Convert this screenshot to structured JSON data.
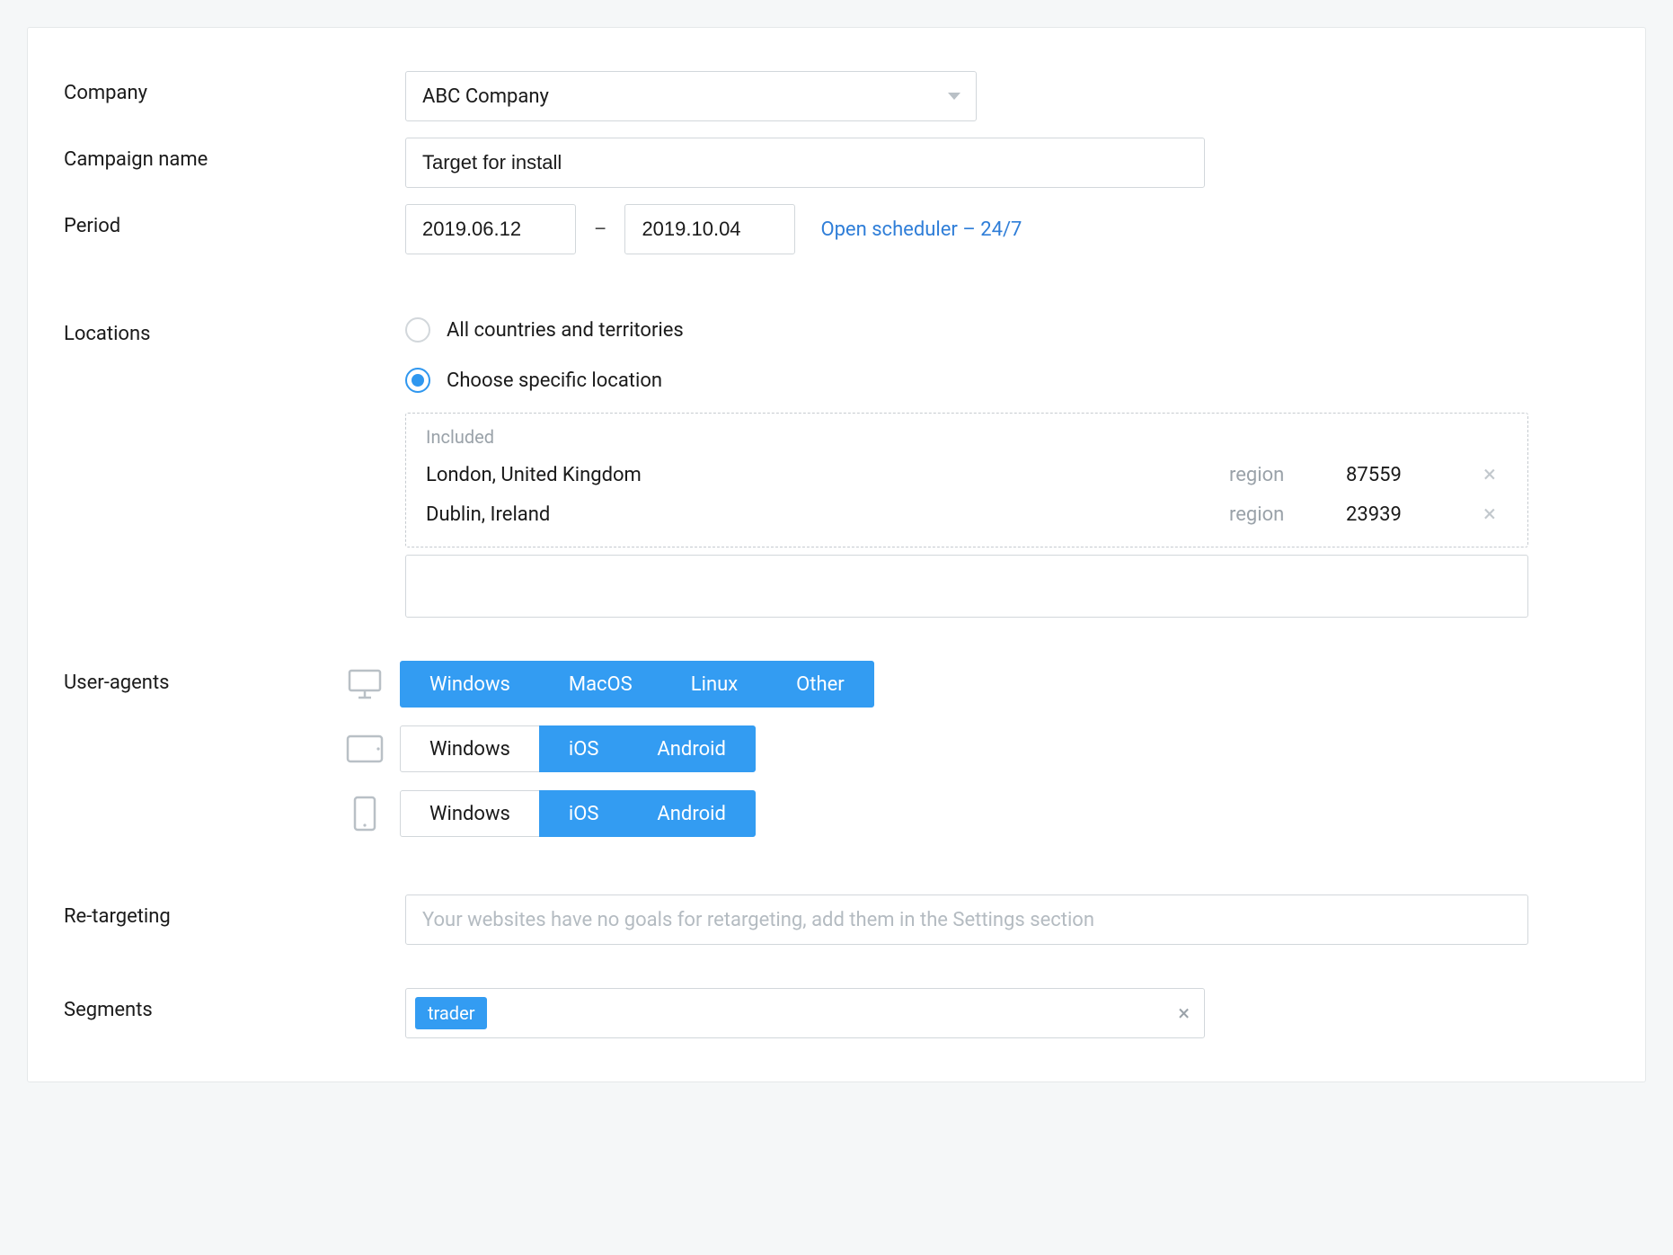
{
  "labels": {
    "company": "Company",
    "campaign_name": "Campaign name",
    "period": "Period",
    "locations": "Locations",
    "user_agents": "User-agents",
    "retargeting": "Re-targeting",
    "segments": "Segments"
  },
  "company": {
    "selected": "ABC Company"
  },
  "campaign_name": {
    "value": "Target for install"
  },
  "period": {
    "from": "2019.06.12",
    "to": "2019.10.04",
    "dash": "–",
    "scheduler_link": "Open scheduler – 24/7"
  },
  "locations": {
    "radio_all": "All countries and territories",
    "radio_specific": "Choose specific location",
    "selected": "specific",
    "included_label": "Included",
    "items": [
      {
        "name": "London, United Kingdom",
        "type": "region",
        "code": "87559"
      },
      {
        "name": "Dublin, Ireland",
        "type": "region",
        "code": "23939"
      }
    ]
  },
  "user_agents": {
    "desktop": [
      {
        "label": "Windows",
        "selected": true
      },
      {
        "label": "MacOS",
        "selected": true
      },
      {
        "label": "Linux",
        "selected": true
      },
      {
        "label": "Other",
        "selected": true
      }
    ],
    "tablet": [
      {
        "label": "Windows",
        "selected": false
      },
      {
        "label": "iOS",
        "selected": true
      },
      {
        "label": "Android",
        "selected": true
      }
    ],
    "mobile": [
      {
        "label": "Windows",
        "selected": false
      },
      {
        "label": "iOS",
        "selected": true
      },
      {
        "label": "Android",
        "selected": true
      }
    ]
  },
  "retargeting": {
    "placeholder": "Your websites have no goals for retargeting, add them in the Settings section"
  },
  "segments": {
    "tags": [
      "trader"
    ]
  }
}
